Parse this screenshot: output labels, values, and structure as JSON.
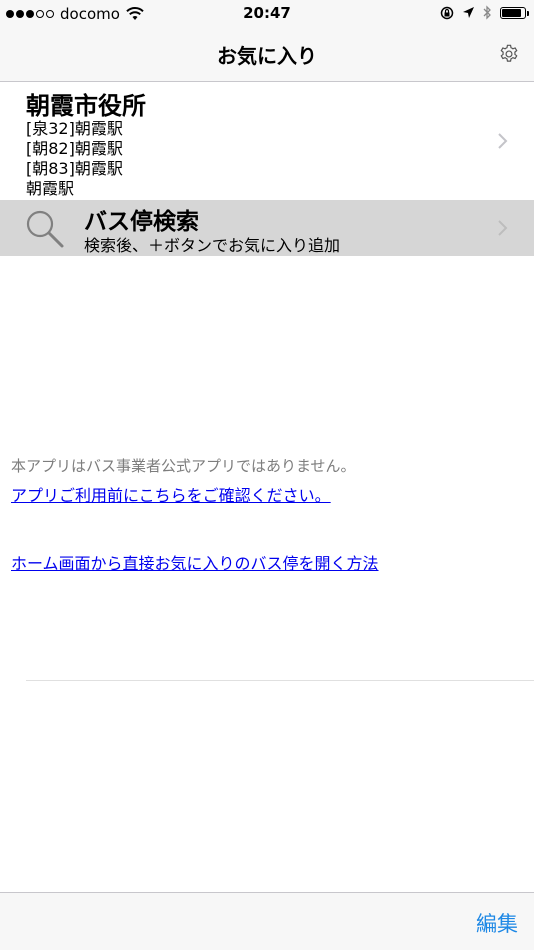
{
  "status_bar": {
    "carrier": "docomo",
    "time": "20:47",
    "signal_filled": 3,
    "signal_total": 5,
    "battery_level": 0.92
  },
  "nav": {
    "title": "お気に入り",
    "settings_icon": "gear-icon"
  },
  "favorites": [
    {
      "stop_name": "朝霞市役所",
      "routes": [
        "[泉32]朝霞駅",
        "[朝82]朝霞駅",
        "[朝83]朝霞駅",
        "朝霞駅"
      ]
    }
  ],
  "search_row": {
    "title": "バス停検索",
    "subtitle": "検索後、＋ボタンでお気に入り追加",
    "icon": "magnifier-icon"
  },
  "notices": {
    "disclaimer": "本アプリはバス事業者公式アプリではありません。",
    "confirm_link": "アプリご利用前にこちらをご確認ください。",
    "howto_link": "ホーム画面から直接お気に入りのバス停を開く方法"
  },
  "toolbar": {
    "edit_label": "編集"
  },
  "colors": {
    "bar_background": "#f7f7f7",
    "search_row_background": "#d6d6d6",
    "link": "#0000ee",
    "accent": "#1e88e5",
    "disclaimer_text": "#7d7d7d"
  }
}
